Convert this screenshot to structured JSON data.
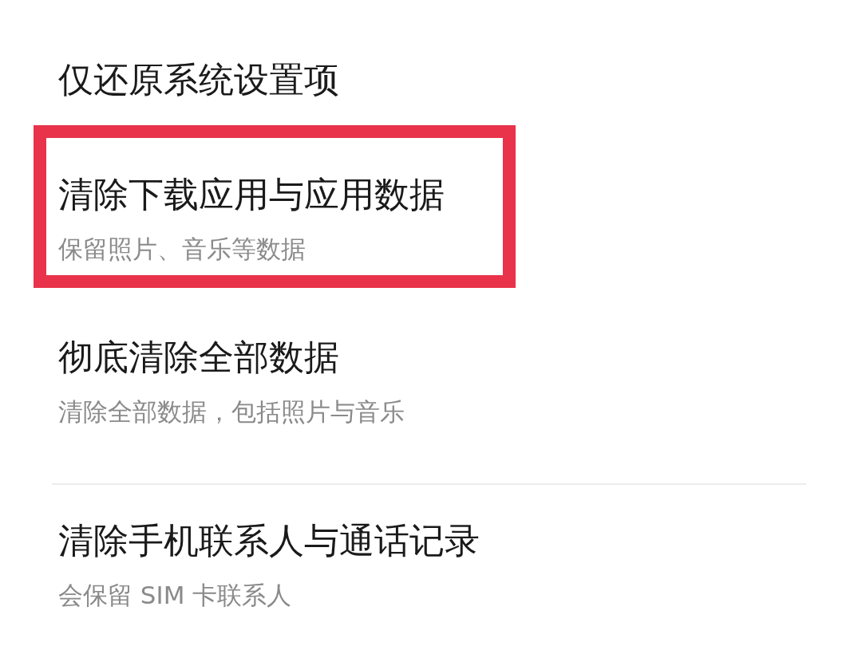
{
  "sections": [
    {
      "items": [
        {
          "title": "仅还原系统设置项",
          "highlighted": false
        },
        {
          "title": "清除下载应用与应用数据",
          "subtitle": "保留照片、音乐等数据",
          "highlighted": true
        },
        {
          "title": "彻底清除全部数据",
          "subtitle": "清除全部数据，包括照片与音乐",
          "highlighted": false
        }
      ]
    },
    {
      "items": [
        {
          "title": "清除手机联系人与通话记录",
          "subtitle": "会保留 SIM 卡联系人",
          "highlighted": false
        }
      ]
    }
  ]
}
